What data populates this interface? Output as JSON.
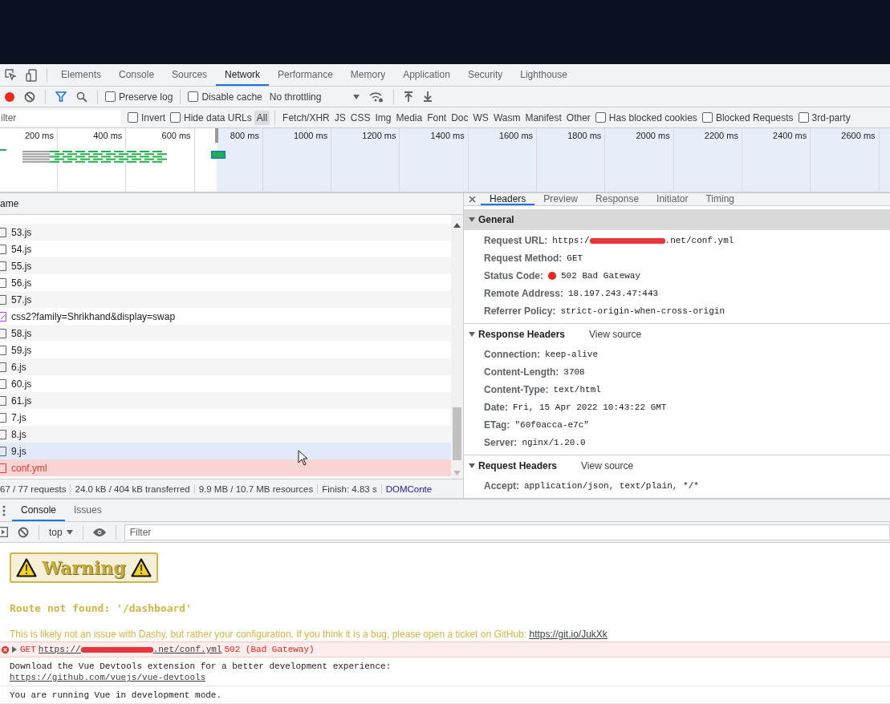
{
  "top_tabs": [
    {
      "label": "Elements",
      "selected": false
    },
    {
      "label": "Console",
      "selected": false
    },
    {
      "label": "Sources",
      "selected": false
    },
    {
      "label": "Network",
      "selected": true
    },
    {
      "label": "Performance",
      "selected": false
    },
    {
      "label": "Memory",
      "selected": false
    },
    {
      "label": "Application",
      "selected": false
    },
    {
      "label": "Security",
      "selected": false
    },
    {
      "label": "Lighthouse",
      "selected": false
    }
  ],
  "toolbar": {
    "recording": true,
    "checkboxes": [
      {
        "label": "Preserve log",
        "checked": false
      },
      {
        "label": "Disable cache",
        "checked": false
      }
    ],
    "throttling": "No throttling"
  },
  "filter_bar": {
    "placeholder": "ilter",
    "checkboxes": [
      {
        "label": "Invert",
        "checked": false
      },
      {
        "label": "Hide data URLs",
        "checked": false
      }
    ],
    "types": [
      {
        "label": "All",
        "selected": true
      },
      {
        "label": "Fetch/XHR",
        "selected": false
      },
      {
        "label": "JS",
        "selected": false
      },
      {
        "label": "CSS",
        "selected": false
      },
      {
        "label": "Img",
        "selected": false
      },
      {
        "label": "Media",
        "selected": false
      },
      {
        "label": "Font",
        "selected": false
      },
      {
        "label": "Doc",
        "selected": false
      },
      {
        "label": "WS",
        "selected": false
      },
      {
        "label": "Wasm",
        "selected": false
      },
      {
        "label": "Manifest",
        "selected": false
      },
      {
        "label": "Other",
        "selected": false
      }
    ],
    "more_checkboxes": [
      {
        "label": "Has blocked cookies",
        "checked": false
      },
      {
        "label": "Blocked Requests",
        "checked": false
      },
      {
        "label": "3rd-party",
        "checked": false
      }
    ]
  },
  "overview": {
    "ticks": [
      "200 ms",
      "400 ms",
      "600 ms",
      "800 ms",
      "1000 ms",
      "1200 ms",
      "1400 ms",
      "1600 ms",
      "1800 ms",
      "2000 ms",
      "2200 ms",
      "2400 ms",
      "2600 ms"
    ]
  },
  "requests": {
    "column": "ame",
    "rows": [
      {
        "name": "53.js",
        "kind": "script",
        "error": false,
        "hovered": false
      },
      {
        "name": "54.js",
        "kind": "script",
        "error": false,
        "hovered": false
      },
      {
        "name": "55.js",
        "kind": "script",
        "error": false,
        "hovered": false
      },
      {
        "name": "56.js",
        "kind": "script",
        "error": false,
        "hovered": false
      },
      {
        "name": "57.js",
        "kind": "script",
        "error": false,
        "hovered": false
      },
      {
        "name": "css2?family=Shrikhand&display=swap",
        "kind": "stylesheet",
        "error": false,
        "hovered": false
      },
      {
        "name": "58.js",
        "kind": "script",
        "error": false,
        "hovered": false
      },
      {
        "name": "59.js",
        "kind": "script",
        "error": false,
        "hovered": false
      },
      {
        "name": "6.js",
        "kind": "script",
        "error": false,
        "hovered": false
      },
      {
        "name": "60.js",
        "kind": "script",
        "error": false,
        "hovered": false
      },
      {
        "name": "61.js",
        "kind": "script",
        "error": false,
        "hovered": false
      },
      {
        "name": "7.js",
        "kind": "script",
        "error": false,
        "hovered": false
      },
      {
        "name": "8.js",
        "kind": "script",
        "error": false,
        "hovered": false
      },
      {
        "name": "9.js",
        "kind": "script",
        "error": false,
        "hovered": true
      },
      {
        "name": "conf.yml",
        "kind": "script",
        "error": true,
        "hovered": false
      }
    ],
    "summary": [
      "67 / 77 requests",
      "24.0 kB / 404 kB transferred",
      "9.9 MB / 10.7 MB resources",
      "Finish: 4.83 s"
    ],
    "summary_link": "DOMConte"
  },
  "details": {
    "tabs": [
      {
        "label": "Headers",
        "selected": true
      },
      {
        "label": "Preview",
        "selected": false
      },
      {
        "label": "Response",
        "selected": false
      },
      {
        "label": "Initiator",
        "selected": false
      },
      {
        "label": "Timing",
        "selected": false
      }
    ],
    "sections": [
      {
        "title": "General",
        "expanded": true,
        "highlighted": true,
        "fields": [
          {
            "kind": "redacted",
            "label": "Request URL:",
            "prefix": "https:/",
            "value": ".net/conf.yml"
          },
          {
            "kind": "text",
            "label": "Request Method:",
            "value": "GET"
          },
          {
            "kind": "status",
            "label": "Status Code:",
            "value": "502 Bad Gateway",
            "color": "#e5271d"
          },
          {
            "kind": "text",
            "label": "Remote Address:",
            "value": "18.197.243.47:443"
          },
          {
            "kind": "text",
            "label": "Referrer Policy:",
            "value": "strict-origin-when-cross-origin"
          }
        ]
      },
      {
        "title": "Response Headers",
        "expanded": true,
        "highlighted": false,
        "action": "View source",
        "fields": [
          {
            "kind": "text",
            "label": "Connection:",
            "value": "keep-alive"
          },
          {
            "kind": "text",
            "label": "Content-Length:",
            "value": "3708"
          },
          {
            "kind": "text",
            "label": "Content-Type:",
            "value": "text/html"
          },
          {
            "kind": "text",
            "label": "Date:",
            "value": "Fri, 15 Apr 2022 10:43:22 GMT"
          },
          {
            "kind": "text",
            "label": "ETag:",
            "value": "\"60f0acca-e7c\""
          },
          {
            "kind": "text",
            "label": "Server:",
            "value": "nginx/1.20.0"
          }
        ]
      },
      {
        "title": "Request Headers",
        "expanded": true,
        "highlighted": false,
        "action": "View source",
        "fields": [
          {
            "kind": "text",
            "label": "Accept:",
            "value": "application/json, text/plain, */*"
          }
        ]
      }
    ]
  },
  "console": {
    "tabs": [
      {
        "label": "Console",
        "selected": true
      },
      {
        "label": "Issues",
        "selected": false
      }
    ],
    "context": "top",
    "placeholder": "Filter",
    "messages": [
      {
        "kind": "badge",
        "text": "Warning"
      },
      {
        "kind": "route",
        "text": "Route not found: '/dashboard'"
      },
      {
        "kind": "note",
        "text": "This is likely not an issue with Dashy, but rather your configuration. If you think it is a bug, please open a ticket on GitHub: ",
        "link": "https://git.io/JukXk"
      },
      {
        "kind": "error",
        "method": "GET",
        "prefix": "https://",
        "value": ".net/conf.yml",
        "status": "502 (Bad Gateway)"
      },
      {
        "kind": "log",
        "text": "Download the Vue Devtools extension for a better development experience:",
        "link": "https://github.com/vuejs/vue-devtools"
      },
      {
        "kind": "log",
        "text": "You are running Vue in development mode."
      }
    ]
  }
}
